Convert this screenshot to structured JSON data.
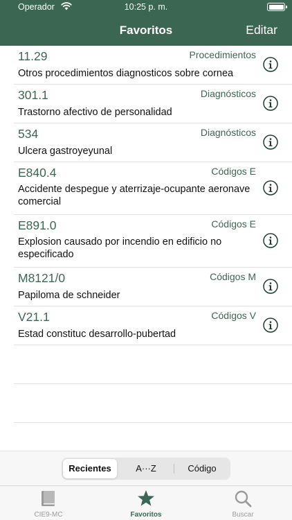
{
  "status": {
    "carrier": "Operador",
    "time": "10:25 p. m."
  },
  "nav": {
    "title": "Favoritos",
    "edit_label": "Editar"
  },
  "colors": {
    "accent": "#3b6651",
    "inactive": "#9a9a9a"
  },
  "items": [
    {
      "code": "11.29",
      "category": "Procedimientos",
      "description": "Otros procedimientos diagnosticos sobre cornea"
    },
    {
      "code": "301.1",
      "category": "Diagnósticos",
      "description": "Trastorno afectivo de personalidad"
    },
    {
      "code": "534",
      "category": "Diagnósticos",
      "description": "Ulcera gastroyeyunal"
    },
    {
      "code": "E840.4",
      "category": "Códigos E",
      "description": "Accidente despegue y aterrizaje-ocupante aeronave comercial"
    },
    {
      "code": "E891.0",
      "category": "Códigos E",
      "description": "Explosion causado por incendio en edificio no especificado"
    },
    {
      "code": "M8121/0",
      "category": "Códigos M",
      "description": "Papiloma de schneider"
    },
    {
      "code": "V21.1",
      "category": "Códigos V",
      "description": "Estad constituc desarrollo-pubertad"
    }
  ],
  "segments": [
    "Recientes",
    "A···Z",
    "Código"
  ],
  "selected_segment": "Recientes",
  "tabs": [
    {
      "label": "CIE9-MC",
      "icon": "book-icon"
    },
    {
      "label": "Favoritos",
      "icon": "star-icon"
    },
    {
      "label": "Buscar",
      "icon": "magnifier-icon"
    }
  ],
  "active_tab": "Favoritos"
}
